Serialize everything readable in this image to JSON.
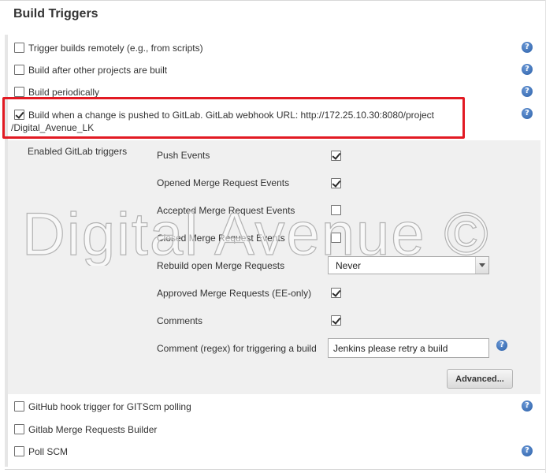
{
  "section": {
    "title": "Build Triggers"
  },
  "triggers": [
    {
      "label": "Trigger builds remotely (e.g., from scripts)",
      "checked": false
    },
    {
      "label": "Build after other projects are built",
      "checked": false
    },
    {
      "label": "Build periodically",
      "checked": false
    },
    {
      "label_line1": "Build when a change is pushed to GitLab. GitLab webhook URL: http://172.25.10.30:8080/project",
      "label_line2": "/Digital_Avenue_LK",
      "checked": true,
      "highlighted": true
    }
  ],
  "gitlab": {
    "heading": "Enabled GitLab triggers",
    "options": [
      {
        "label": "Push Events",
        "checked": true
      },
      {
        "label": "Opened Merge Request Events",
        "checked": true
      },
      {
        "label": "Accepted Merge Request Events",
        "checked": false
      },
      {
        "label": "Closed Merge Request Events",
        "checked": false
      }
    ],
    "rebuild": {
      "label": "Rebuild open Merge Requests",
      "value": "Never"
    },
    "options2": [
      {
        "label": "Approved Merge Requests (EE-only)",
        "checked": true
      },
      {
        "label": "Comments",
        "checked": true
      }
    ],
    "comment_regex": {
      "label": "Comment (regex) for triggering a build",
      "value": "Jenkins please retry a build"
    },
    "advanced_label": "Advanced..."
  },
  "more_triggers": [
    {
      "label": "GitHub hook trigger for GITScm polling",
      "checked": false
    },
    {
      "label": "Gitlab Merge Requests Builder",
      "checked": false
    },
    {
      "label": "Poll SCM",
      "checked": false
    }
  ],
  "help_glyph": "?",
  "watermark": "Digital Avenue ©",
  "colors": {
    "highlight": "#e21a23",
    "help": "#2a5fa8",
    "shade": "#f0f0f0"
  }
}
